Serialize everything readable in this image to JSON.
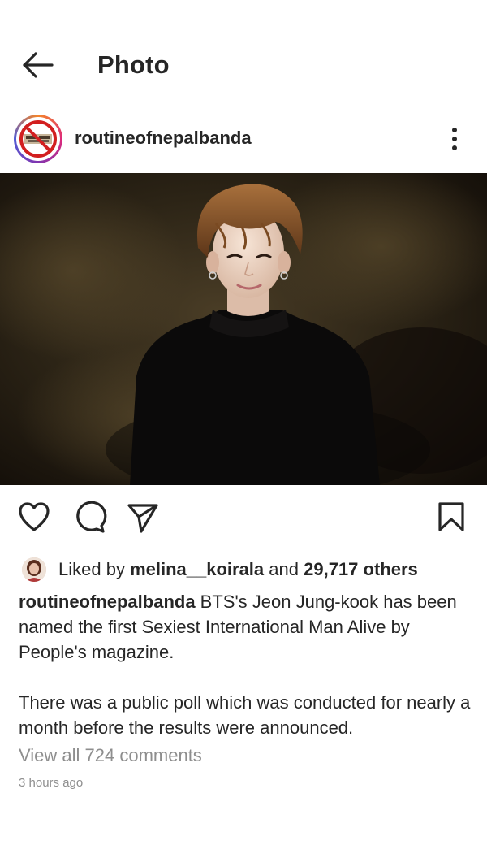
{
  "header": {
    "title": "Photo",
    "back_icon": "arrow-left-icon"
  },
  "post": {
    "username": "routineofnepalbanda",
    "avatar_icon": "no-entry-logo-icon",
    "more_icon": "vertical-dots-icon",
    "photo_alt": "man in black sweater against dark background"
  },
  "actions": {
    "like_icon": "heart-icon",
    "comment_icon": "comment-bubble-icon",
    "share_icon": "paper-plane-icon",
    "save_icon": "bookmark-icon"
  },
  "likes": {
    "prefix": "Liked by ",
    "user": "melina__koirala",
    "middle": " and ",
    "count": "29,717 others"
  },
  "caption": {
    "username": "routineofnepalbanda",
    "text_1": " BTS's Jeon Jung-kook has been named the first Sexiest International Man Alive by People's magazine.",
    "text_2": "There was a public poll which was conducted for nearly a  month before the results were announced."
  },
  "comments": {
    "view_all": "View all 724 comments"
  },
  "timestamp": "3 hours ago",
  "colors": {
    "text": "#262626",
    "secondary": "#8e8e8e",
    "background": "#ffffff"
  }
}
